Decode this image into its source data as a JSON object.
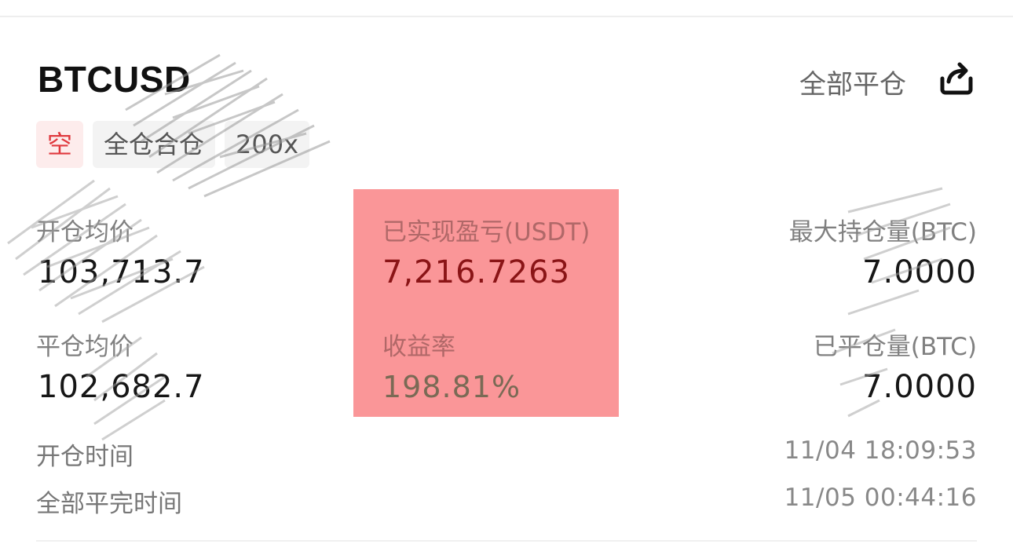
{
  "header": {
    "symbol": "BTCUSD",
    "close_all_label": "全部平仓",
    "share_icon": "share-icon"
  },
  "tags": {
    "side": "空",
    "margin_mode": "全仓合仓",
    "leverage": "200x"
  },
  "stats": {
    "open_avg_price_label": "开仓均价",
    "open_avg_price_value": "103,713.7",
    "realized_pnl_label": "已实现盈亏(USDT)",
    "realized_pnl_value": "7,216.7263",
    "max_position_label": "最大持仓量(BTC)",
    "max_position_value": "7.0000",
    "close_avg_price_label": "平仓均价",
    "close_avg_price_value": "102,682.7",
    "roi_label": "收益率",
    "roi_value": "198.81%",
    "closed_qty_label": "已平仓量(BTC)",
    "closed_qty_value": "7.0000"
  },
  "times": {
    "open_time_label": "开仓时间",
    "open_time_value": "11/04 18:09:53",
    "close_time_label": "全部平完时间",
    "close_time_value": "11/05 00:44:16"
  },
  "colors": {
    "short_red": "#e0393e",
    "highlight": "#fa9698",
    "pnl_red": "#8a1416"
  }
}
